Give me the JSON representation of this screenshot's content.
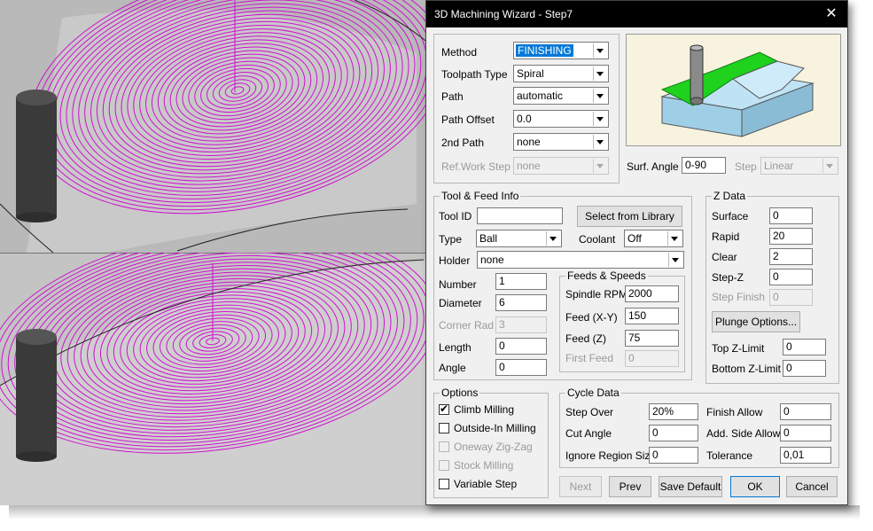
{
  "dialog": {
    "title": "3D Machining Wizard - Step7",
    "close_glyph": "✕"
  },
  "method": {
    "method_label": "Method",
    "method_value": "FINISHING",
    "toolpath_type_label": "Toolpath Type",
    "toolpath_type_value": "Spiral",
    "path_label": "Path",
    "path_value": "automatic",
    "path_offset_label": "Path Offset",
    "path_offset_value": "0.0",
    "second_path_label": "2nd Path",
    "second_path_value": "none",
    "ref_work_step_label": "Ref.Work Step",
    "ref_work_step_value": "none"
  },
  "surface": {
    "surf_angle_label": "Surf. Angle",
    "surf_angle_value": "0-90",
    "step_label": "Step",
    "step_value": "Linear"
  },
  "tool_feed": {
    "group_title": "Tool & Feed Info",
    "tool_id_label": "Tool ID",
    "tool_id_value": "",
    "select_library_label": "Select from Library",
    "type_label": "Type",
    "type_value": "Ball",
    "coolant_label": "Coolant",
    "coolant_value": "Off",
    "holder_label": "Holder",
    "holder_value": "none",
    "number_label": "Number",
    "number_value": "1",
    "diameter_label": "Diameter",
    "diameter_value": "6",
    "corner_rad_label": "Corner Rad",
    "corner_rad_value": "3",
    "length_label": "Length",
    "length_value": "0",
    "angle_label": "Angle",
    "angle_value": "0"
  },
  "feeds_speeds": {
    "group_title": "Feeds & Speeds",
    "spindle_rpm_label": "Spindle RPM",
    "spindle_rpm_value": "2000",
    "feed_xy_label": "Feed (X-Y)",
    "feed_xy_value": "150",
    "feed_z_label": "Feed (Z)",
    "feed_z_value": "75",
    "first_feed_label": "First Feed",
    "first_feed_value": "0"
  },
  "z_data": {
    "group_title": "Z Data",
    "surface_label": "Surface",
    "surface_value": "0",
    "rapid_label": "Rapid",
    "rapid_value": "20",
    "clear_label": "Clear",
    "clear_value": "2",
    "step_z_label": "Step-Z",
    "step_z_value": "0",
    "step_finish_label": "Step Finish",
    "step_finish_value": "0",
    "plunge_options_label": "Plunge Options...",
    "top_z_limit_label": "Top Z-Limit",
    "top_z_limit_value": "0",
    "bottom_z_limit_label": "Bottom Z-Limit",
    "bottom_z_limit_value": "0"
  },
  "options": {
    "group_title": "Options",
    "climb_milling": "Climb Milling",
    "outside_in_milling": "Outside-In Milling",
    "oneway_zigzag": "Oneway Zig-Zag",
    "stock_milling": "Stock Milling",
    "variable_step": "Variable Step",
    "check_glyph": "✔"
  },
  "cycle_data": {
    "group_title": "Cycle Data",
    "step_over_label": "Step Over",
    "step_over_value": "20%",
    "finish_allow_label": "Finish Allow",
    "finish_allow_value": "0",
    "cut_angle_label": "Cut Angle",
    "cut_angle_value": "0",
    "add_side_allow_label": "Add. Side Allow",
    "add_side_allow_value": "0",
    "ignore_region_label": "Ignore Region Size",
    "ignore_region_value": "0",
    "tolerance_label": "Tolerance",
    "tolerance_value": "0,01"
  },
  "buttons": {
    "next": "Next",
    "prev": "Prev",
    "save_default": "Save Default",
    "ok": "OK",
    "cancel": "Cancel"
  },
  "colors": {
    "toolpath": "#d010d0",
    "surface": "#c8c8c8",
    "cutter": "#3a3a3a",
    "preview_bg": "#f8f3de",
    "preview_green": "#1ed21e",
    "preview_block": "#bfe3f5"
  }
}
